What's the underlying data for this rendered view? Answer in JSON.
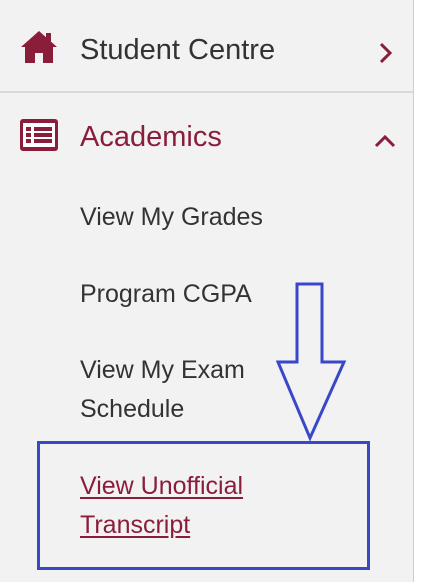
{
  "colors": {
    "accent": "#8a1e3a",
    "text": "#333333",
    "annotation": "#3a48c8",
    "background": "#f2f2f2"
  },
  "nav": {
    "student_centre": {
      "label": "Student Centre",
      "icon": "home-icon",
      "chevron": "chevron-right-icon"
    },
    "academics": {
      "label": "Academics",
      "icon": "list-icon",
      "chevron": "chevron-up-icon",
      "expanded": true,
      "items": [
        {
          "label": "View My Grades"
        },
        {
          "label": "Program CGPA"
        },
        {
          "label_line1": "View My Exam",
          "label_line2": "Schedule"
        },
        {
          "label_line1": "View Unofficial",
          "label_line2": "Transcript",
          "active": true
        }
      ]
    }
  },
  "annotation": {
    "type": "down-arrow-with-box",
    "icon": "down-arrow-icon"
  }
}
